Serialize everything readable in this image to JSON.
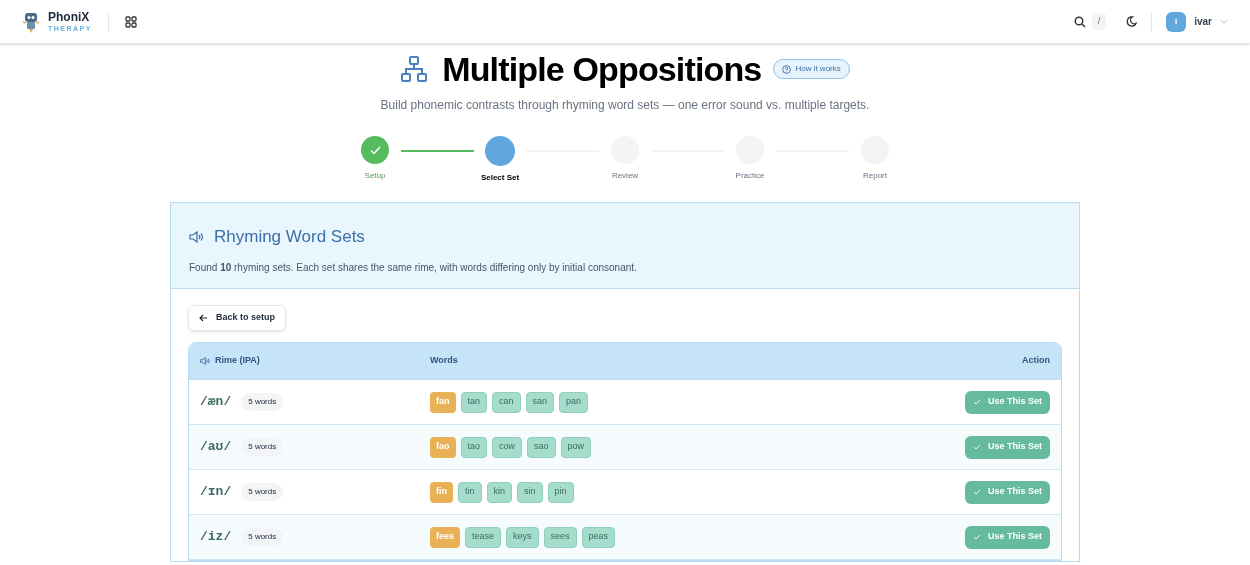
{
  "app": {
    "name": "PhoniX",
    "tagline": "THERAPY"
  },
  "topbar": {
    "search_shortcut": "/",
    "user": {
      "initial": "I",
      "name": "ivar"
    }
  },
  "page": {
    "title": "Multiple Oppositions",
    "help_button": "How it works",
    "subtitle": "Build phonemic contrasts through rhyming word sets — one error sound vs. multiple targets."
  },
  "steps": [
    {
      "label": "Setup",
      "kind": "done"
    },
    {
      "label": "Select Set",
      "kind": "current"
    },
    {
      "label": "Review",
      "kind": "pending"
    },
    {
      "label": "Practice",
      "kind": "pending"
    },
    {
      "label": "Report",
      "kind": "pending"
    }
  ],
  "card": {
    "title": "Rhyming Word Sets",
    "description": "Found **10** rhyming sets. Each set shares the same rime, with words differing only by initial consonant.",
    "back_button": "Back to setup"
  },
  "table": {
    "columns": [
      "Rime (IPA)",
      "Words",
      "Action"
    ],
    "rows": [
      {
        "rime": "/æn/",
        "count": "5 words",
        "words": [
          {
            "text": "fan",
            "kind": "error"
          },
          {
            "text": "tan",
            "kind": "target"
          },
          {
            "text": "can",
            "kind": "target"
          },
          {
            "text": "san",
            "kind": "target"
          },
          {
            "text": "pan",
            "kind": "target"
          }
        ],
        "action": "Use This Set"
      },
      {
        "rime": "/aʊ/",
        "count": "5 words",
        "words": [
          {
            "text": "fao",
            "kind": "error"
          },
          {
            "text": "tao",
            "kind": "target"
          },
          {
            "text": "cow",
            "kind": "target"
          },
          {
            "text": "sao",
            "kind": "target"
          },
          {
            "text": "pow",
            "kind": "target"
          }
        ],
        "action": "Use This Set"
      },
      {
        "rime": "/ɪn/",
        "count": "5 words",
        "words": [
          {
            "text": "fin",
            "kind": "error"
          },
          {
            "text": "tin",
            "kind": "target"
          },
          {
            "text": "kin",
            "kind": "target"
          },
          {
            "text": "sin",
            "kind": "target"
          },
          {
            "text": "pin",
            "kind": "target"
          }
        ],
        "action": "Use This Set"
      },
      {
        "rime": "/iz/",
        "count": "5 words",
        "words": [
          {
            "text": "fees",
            "kind": "error"
          },
          {
            "text": "tease",
            "kind": "target"
          },
          {
            "text": "keys",
            "kind": "target"
          },
          {
            "text": "sees",
            "kind": "target"
          },
          {
            "text": "peas",
            "kind": "target"
          }
        ],
        "action": "Use This Set"
      }
    ]
  }
}
